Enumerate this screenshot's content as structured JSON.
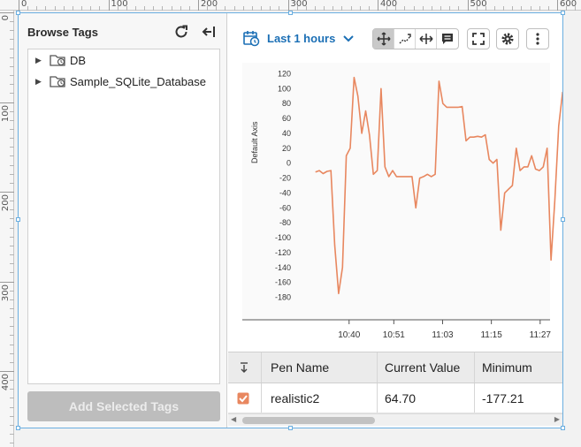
{
  "ruler": {
    "top_labels": [
      "0",
      "100",
      "200",
      "300",
      "400",
      "500",
      "600"
    ],
    "left_labels": [
      "0",
      "100",
      "200",
      "300",
      "400"
    ]
  },
  "browse": {
    "title": "Browse Tags",
    "tree": [
      {
        "label": "DB"
      },
      {
        "label": "Sample_SQLite_Database"
      }
    ],
    "add_button": "Add Selected Tags"
  },
  "toolbar": {
    "range_label": "Last 1 hours",
    "icons": [
      "calendar-clock-icon",
      "chevron-down-icon",
      "pan-icon",
      "zoom-icon",
      "x-zoom-icon",
      "annotation-icon",
      "fullscreen-icon",
      "gear-icon",
      "more-vertical-icon"
    ]
  },
  "colors": {
    "accent": "#1b6fb5",
    "series": "#e8875f",
    "checkbox": "#e8875f"
  },
  "chart_data": {
    "type": "line",
    "ylabel": "Default Axis",
    "ylim": [
      -190,
      130
    ],
    "yticks": [
      "120",
      "100",
      "80",
      "60",
      "40",
      "20",
      "0",
      "-20",
      "-40",
      "-60",
      "-80",
      "-100",
      "-120",
      "-140",
      "-160",
      "-180"
    ],
    "xticks": [
      "10:40",
      "10:51",
      "11:03",
      "11:15",
      "11:27"
    ],
    "x_minutes": [
      30,
      31,
      32,
      33,
      34,
      35,
      36,
      37,
      38,
      39,
      40,
      41,
      42,
      43,
      44,
      45,
      46,
      47,
      48,
      49,
      50,
      51,
      52,
      53,
      54,
      55,
      56,
      57,
      58,
      59,
      60,
      61,
      62,
      63,
      64,
      65,
      66,
      67,
      68,
      69,
      70,
      71,
      72,
      73,
      74,
      75,
      76,
      77,
      78,
      79,
      80,
      81,
      82,
      83,
      84,
      85,
      86,
      87,
      88,
      89
    ],
    "series": [
      {
        "name": "realistic2",
        "values": [
          -12,
          -10,
          -14,
          -11,
          -10,
          -110,
          -175,
          -140,
          10,
          20,
          115,
          90,
          40,
          70,
          38,
          -15,
          -10,
          100,
          -5,
          -18,
          -10,
          -18,
          -18,
          -18,
          -18,
          -18,
          -60,
          -20,
          -18,
          -15,
          -18,
          -15,
          110,
          80,
          75,
          75,
          75,
          75,
          76,
          30,
          35,
          35,
          36,
          35,
          38,
          5,
          0,
          5,
          -90,
          -40,
          -35,
          -30,
          20,
          -10,
          -5,
          -5,
          10,
          -8,
          -10,
          -5,
          20,
          -130,
          -50,
          50,
          95,
          65
        ]
      }
    ]
  },
  "table": {
    "headers": {
      "pen": "Pen Name",
      "current": "Current Value",
      "minimum": "Minimum"
    },
    "rows": [
      {
        "pen": "realistic2",
        "current": "64.70",
        "minimum": "-177.21"
      }
    ]
  }
}
